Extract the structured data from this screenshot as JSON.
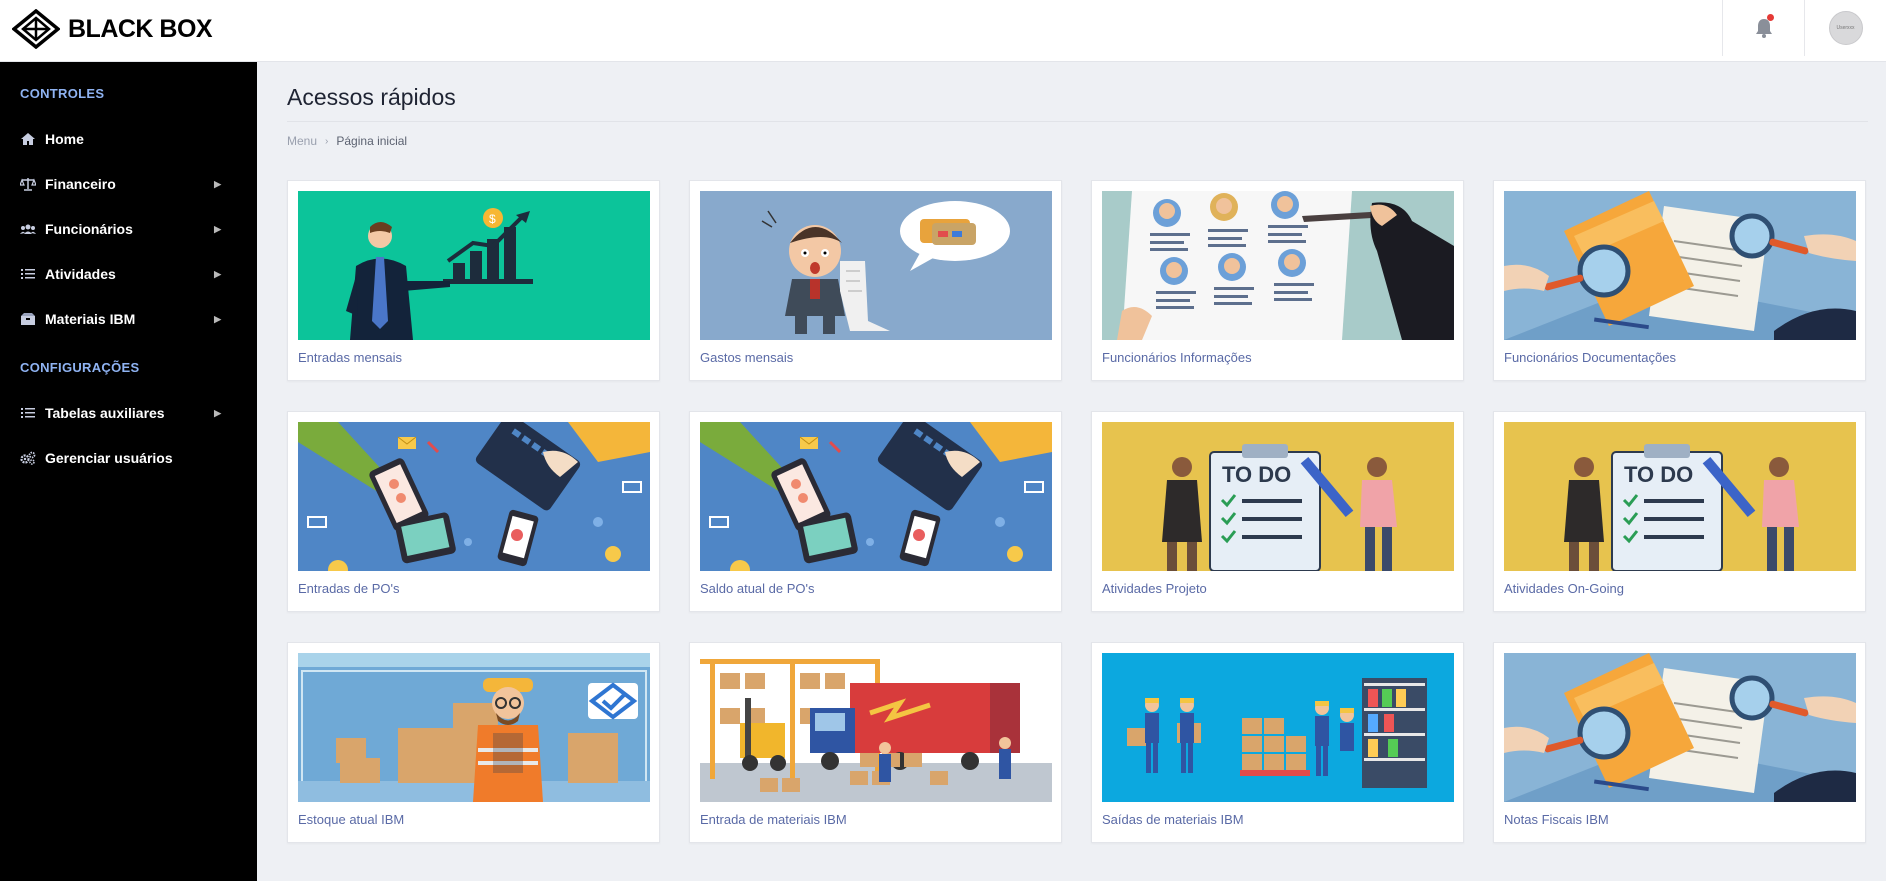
{
  "brand": {
    "name": "BLACK BOX"
  },
  "header": {
    "notification_icon": "bell-icon",
    "avatar_text": "Userxxx"
  },
  "sidebar": {
    "sections": [
      {
        "title": "CONTROLES"
      },
      {
        "title": "CONFIGURAÇÕES"
      }
    ],
    "items": [
      {
        "label": "Home",
        "icon": "home-icon",
        "has_submenu": false
      },
      {
        "label": "Financeiro",
        "icon": "scale-icon",
        "has_submenu": true
      },
      {
        "label": "Funcionários",
        "icon": "users-icon",
        "has_submenu": true
      },
      {
        "label": "Atividades",
        "icon": "list-icon",
        "has_submenu": true
      },
      {
        "label": "Materiais IBM",
        "icon": "boxes-icon",
        "has_submenu": true
      },
      {
        "label": "Tabelas auxiliares",
        "icon": "list-icon",
        "has_submenu": true
      },
      {
        "label": "Gerenciar usuários",
        "icon": "gears-icon",
        "has_submenu": false
      }
    ],
    "submenu_indicator": "›"
  },
  "main": {
    "title": "Acessos rápidos",
    "breadcrumb": {
      "root": "Menu",
      "separator": "›",
      "current": "Página inicial"
    },
    "cards": [
      {
        "label": "Entradas mensais"
      },
      {
        "label": "Gastos mensais"
      },
      {
        "label": "Funcionários Informações"
      },
      {
        "label": "Funcionários Documentações"
      },
      {
        "label": "Entradas de PO's"
      },
      {
        "label": "Saldo atual de PO's"
      },
      {
        "label": "Atividades Projeto"
      },
      {
        "label": "Atividades On-Going"
      },
      {
        "label": "Estoque atual IBM"
      },
      {
        "label": "Entrada de materiais IBM"
      },
      {
        "label": "Saídas de materiais IBM"
      },
      {
        "label": "Notas Fiscais IBM"
      }
    ],
    "todo_text": "TO DO"
  },
  "colors": {
    "sidebar_bg": "#000000",
    "section_title": "#8fb3f2",
    "card_label": "#5a6aa6",
    "page_bg": "#eef0f4"
  }
}
